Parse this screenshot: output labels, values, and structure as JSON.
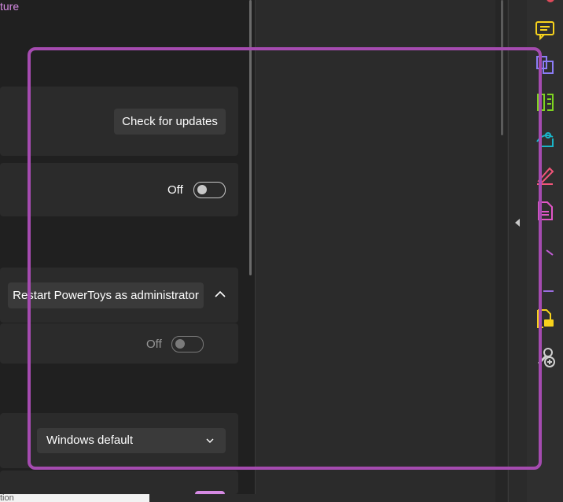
{
  "header": {
    "partial_title": "ture"
  },
  "updates": {
    "check_button": "Check for updates"
  },
  "toggle_row": {
    "state_label": "Off"
  },
  "admin": {
    "restart_button": "Restart PowerToys as administrator",
    "sub_state_label": "Off"
  },
  "theme": {
    "selected": "Windows default"
  },
  "bottom_bar": {
    "partial_text": "tion"
  },
  "tools": [
    {
      "icon": "comment-icon",
      "color": "#f7d21c"
    },
    {
      "icon": "combine-files-icon",
      "color": "#8b7cf6"
    },
    {
      "icon": "organize-pages-icon",
      "color": "#7ed321"
    },
    {
      "icon": "export-pdf-icon",
      "color": "#1ab5c8"
    },
    {
      "icon": "edit-pdf-icon",
      "color": "#f2557a"
    },
    {
      "icon": "create-pdf-icon",
      "color": "#e256c8"
    },
    {
      "icon": "fill-sign-icon",
      "color": "#c45dd8"
    },
    {
      "icon": "request-signature-icon",
      "color": "#9b6de0"
    },
    {
      "icon": "comment-doc-icon",
      "color": "#f7d21c"
    },
    {
      "icon": "more-tools-icon",
      "color": "#d0d0d0"
    }
  ]
}
